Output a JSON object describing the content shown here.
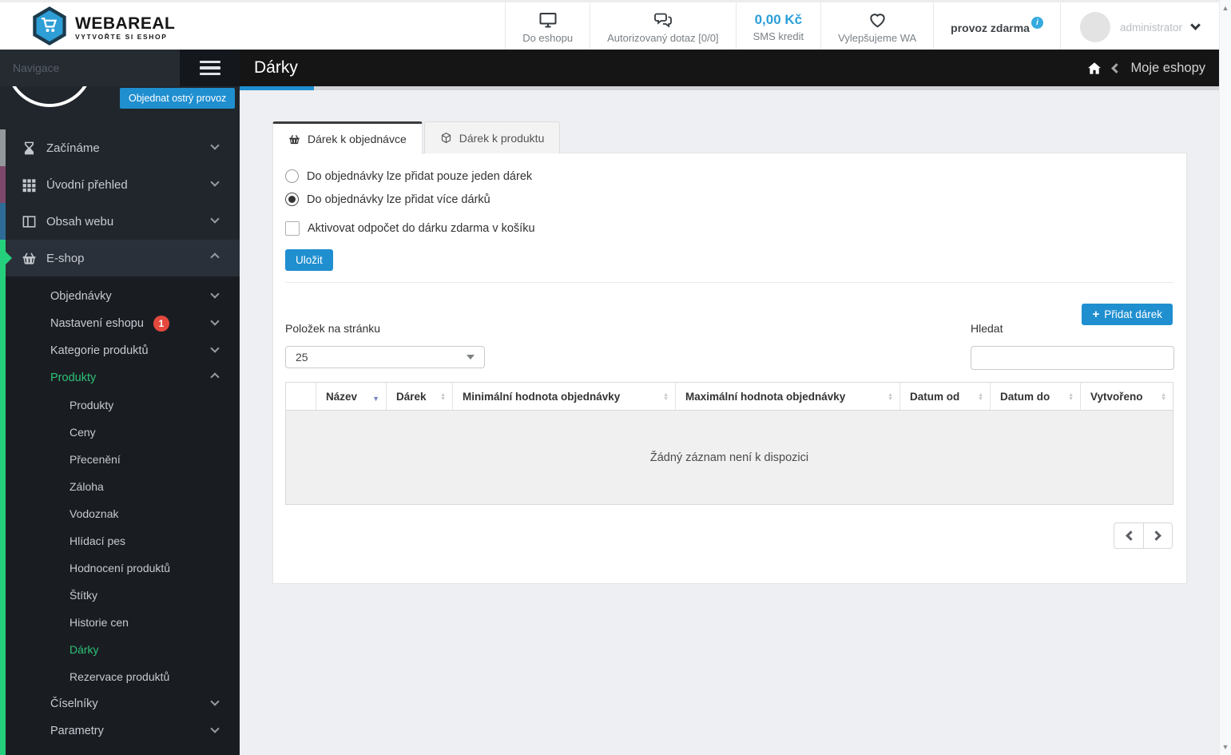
{
  "brand": {
    "name": "WEBAREAL",
    "tagline": "VYTVOŘTE SI ESHOP",
    "logo_icon": "hexagon-cart-icon"
  },
  "header": {
    "do_eshopu": {
      "icon": "monitor-icon",
      "label": "Do eshopu"
    },
    "dotaz": {
      "icon": "chat-bubbles-icon",
      "label": "Autorizovaný dotaz [0/0]"
    },
    "sms": {
      "value": "0,00 Kč",
      "label": "SMS kredit"
    },
    "vylepsujeme": {
      "icon": "heart-icon",
      "label": "Vylepšujeme WA"
    },
    "provoz": {
      "label": "provoz zdarma",
      "info_glyph": "i"
    },
    "user": {
      "name": "administrator",
      "icon": "avatar",
      "chevron": "chevron-down-icon"
    }
  },
  "sidebar": {
    "search_placeholder": "Navigace",
    "order_button": "Objednat ostrý provoz",
    "menu": [
      {
        "label": "Začínáme",
        "icon": "hourglass-icon",
        "level": 0,
        "strip": "#93989c"
      },
      {
        "label": "Úvodní přehled",
        "icon": "grid-icon",
        "level": 0,
        "strip": "#7e486a"
      },
      {
        "label": "Obsah webu",
        "icon": "columns-icon",
        "level": 0,
        "strip": "#2e6b97"
      },
      {
        "label": "E-shop",
        "icon": "basket-icon",
        "level": 0,
        "strip": "#25d07c",
        "expanded": true
      },
      {
        "label": "Objednávky",
        "level": 1
      },
      {
        "label": "Nastavení eshopu",
        "level": 1,
        "badge": "1"
      },
      {
        "label": "Kategorie produktů",
        "level": 1
      },
      {
        "label": "Produkty",
        "level": 1,
        "expanded": true,
        "active": true
      },
      {
        "label": "Produkty",
        "level": 2
      },
      {
        "label": "Ceny",
        "level": 2
      },
      {
        "label": "Přecenění",
        "level": 2
      },
      {
        "label": "Záloha",
        "level": 2
      },
      {
        "label": "Vodoznak",
        "level": 2
      },
      {
        "label": "Hlídací pes",
        "level": 2
      },
      {
        "label": "Hodnocení produktů",
        "level": 2
      },
      {
        "label": "Štítky",
        "level": 2
      },
      {
        "label": "Historie cen",
        "level": 2
      },
      {
        "label": "Dárky",
        "level": 2,
        "active": true
      },
      {
        "label": "Rezervace produktů",
        "level": 2
      },
      {
        "label": "Číselníky",
        "level": 1
      },
      {
        "label": "Parametry",
        "level": 1
      }
    ]
  },
  "page": {
    "title": "Dárky",
    "breadcrumb": {
      "home_icon": "home-icon",
      "label": "Moje eshopy"
    },
    "tabs": [
      {
        "icon": "basket-icon",
        "label": "Dárek k objednávce",
        "active": true
      },
      {
        "icon": "package-icon",
        "label": "Dárek k produktu",
        "active": false
      }
    ],
    "settings": {
      "radio_single": {
        "label": "Do objednávky lze přidat pouze jeden dárek",
        "checked": false
      },
      "radio_multiple": {
        "label": "Do objednávky lze přidat více dárků",
        "checked": true
      },
      "checkbox_discount": {
        "label": "Aktivovat odpočet do dárku zdarma v košíku",
        "checked": false
      },
      "save_button": "Uložit"
    },
    "toolbar": {
      "add_button": "Přidat dárek",
      "plus_glyph": "+",
      "per_page_label": "Položek na stránku",
      "per_page_value": "25",
      "search_label": "Hledat",
      "search_value": ""
    },
    "table": {
      "columns": [
        "",
        "Název",
        "Dárek",
        "Minimální hodnota objednávky",
        "Maximální hodnota objednávky",
        "Datum od",
        "Datum do",
        "Vytvořeno"
      ],
      "sorted_column": "Název",
      "sort_direction": "desc",
      "rows": [],
      "empty_text": "Žádný záznam není k dispozici"
    }
  }
}
